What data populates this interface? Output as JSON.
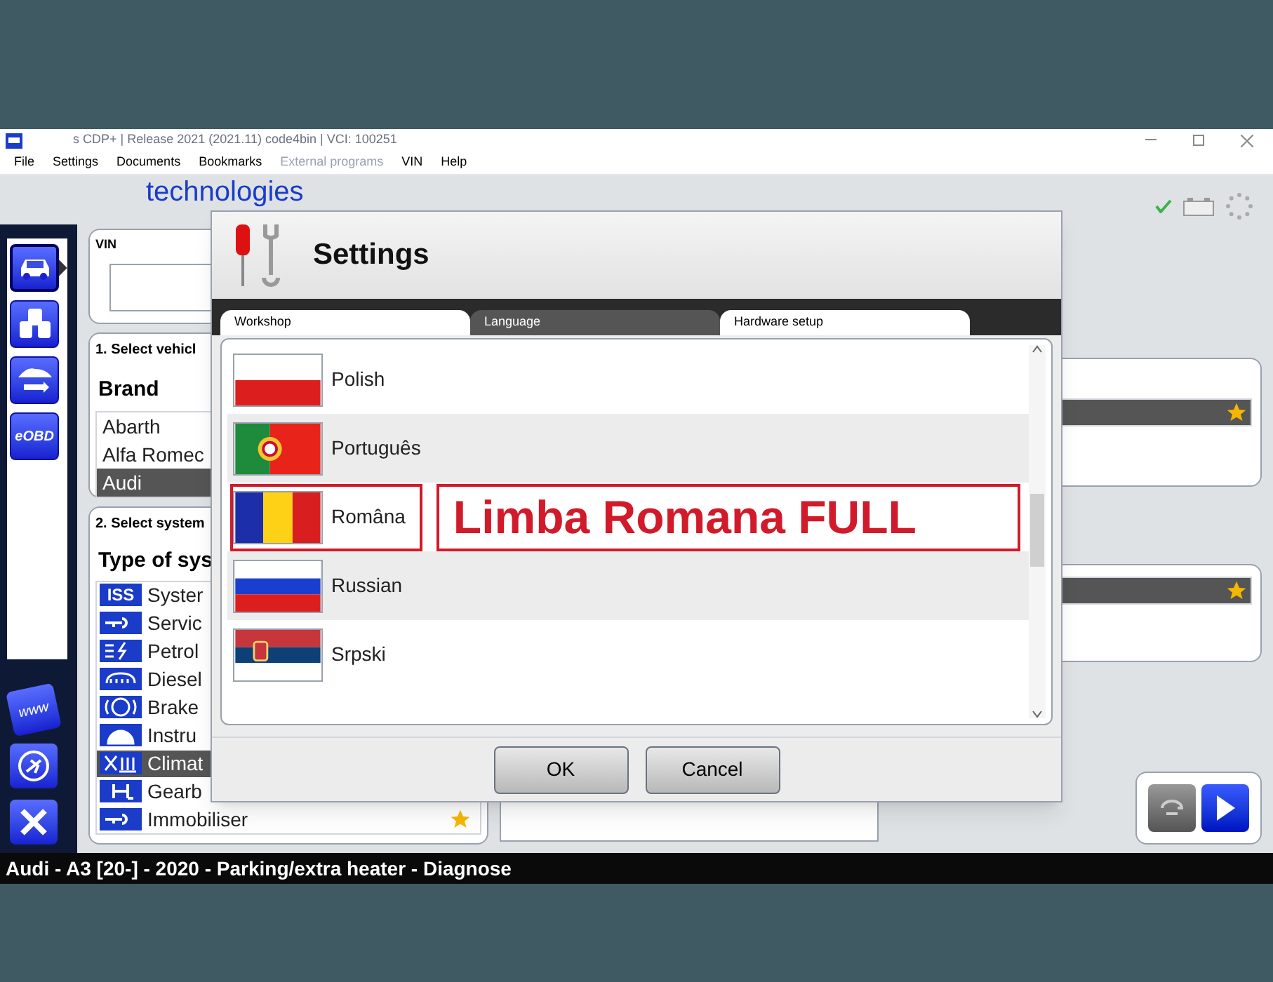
{
  "title_bar": {
    "title": "s CDP+ | Release 2021 (2021.11) code4bin | VCI: 100251"
  },
  "menu": [
    {
      "label": "File",
      "disabled": false
    },
    {
      "label": "Settings",
      "disabled": false
    },
    {
      "label": "Documents",
      "disabled": false
    },
    {
      "label": "Bookmarks",
      "disabled": false
    },
    {
      "label": "External programs",
      "disabled": true
    },
    {
      "label": "VIN",
      "disabled": false
    },
    {
      "label": "Help",
      "disabled": false
    }
  ],
  "logo": {
    "text": "technologies"
  },
  "sidebar": {
    "top": [
      {
        "kind": "car",
        "selected": true
      },
      {
        "kind": "vehicles",
        "selected": false
      },
      {
        "kind": "car-swap",
        "selected": false
      },
      {
        "kind": "text",
        "label": "eOBD",
        "selected": false
      }
    ],
    "bottom": [
      {
        "kind": "text",
        "label": "www"
      },
      {
        "kind": "plane"
      },
      {
        "kind": "close"
      }
    ]
  },
  "vin_panel": {
    "title": "VIN"
  },
  "vehicle_panel": {
    "title": "1. Select vehicl",
    "label": "Brand",
    "brands": [
      {
        "name": "Abarth",
        "selected": false
      },
      {
        "name": "Alfa Romec",
        "selected": false
      },
      {
        "name": "Audi",
        "selected": true
      }
    ]
  },
  "system_panel": {
    "title": "2. Select system",
    "label": "Type of sys",
    "systems": [
      {
        "badge": "ISS",
        "name": "Syster",
        "selected": false
      },
      {
        "kind": "key",
        "name": "Servic",
        "selected": false
      },
      {
        "kind": "fuel",
        "name": "Petrol",
        "selected": false
      },
      {
        "kind": "glow",
        "name": "Diesel",
        "selected": false
      },
      {
        "kind": "abs",
        "name": "Brake",
        "selected": false
      },
      {
        "kind": "gauge",
        "name": "Instru",
        "selected": false
      },
      {
        "kind": "climate",
        "name": "Climat",
        "selected": true
      },
      {
        "kind": "gear",
        "name": "Gearb",
        "selected": false
      },
      {
        "kind": "key",
        "name": "Immobiliser",
        "selected": false,
        "favorite": true
      }
    ]
  },
  "right_panels": [
    {
      "rows": [
        {
          "selected": true,
          "favorite": true
        }
      ]
    },
    {
      "rows": [
        {
          "selected": true,
          "favorite": true
        }
      ]
    }
  ],
  "dialog": {
    "title": "Settings",
    "tabs": [
      {
        "label": "Workshop",
        "selected": false
      },
      {
        "label": "Language",
        "selected": true
      },
      {
        "label": "Hardware setup",
        "selected": false
      }
    ],
    "languages": [
      {
        "name": "Polish",
        "kind": "pl",
        "highlighted": false
      },
      {
        "name": "Português",
        "kind": "pt",
        "highlighted": false
      },
      {
        "name": "Româna",
        "kind": "ro",
        "highlighted": true
      },
      {
        "name": "Russian",
        "kind": "ru",
        "highlighted": false
      },
      {
        "name": "Srpski",
        "kind": "rs",
        "highlighted": false
      }
    ],
    "annotation": "Limba Romana FULL",
    "buttons": [
      "OK",
      "Cancel"
    ]
  },
  "status_bar": {
    "text": "Audi - A3 [20-] - 2020 - Parking/extra heater - Diagnose"
  }
}
